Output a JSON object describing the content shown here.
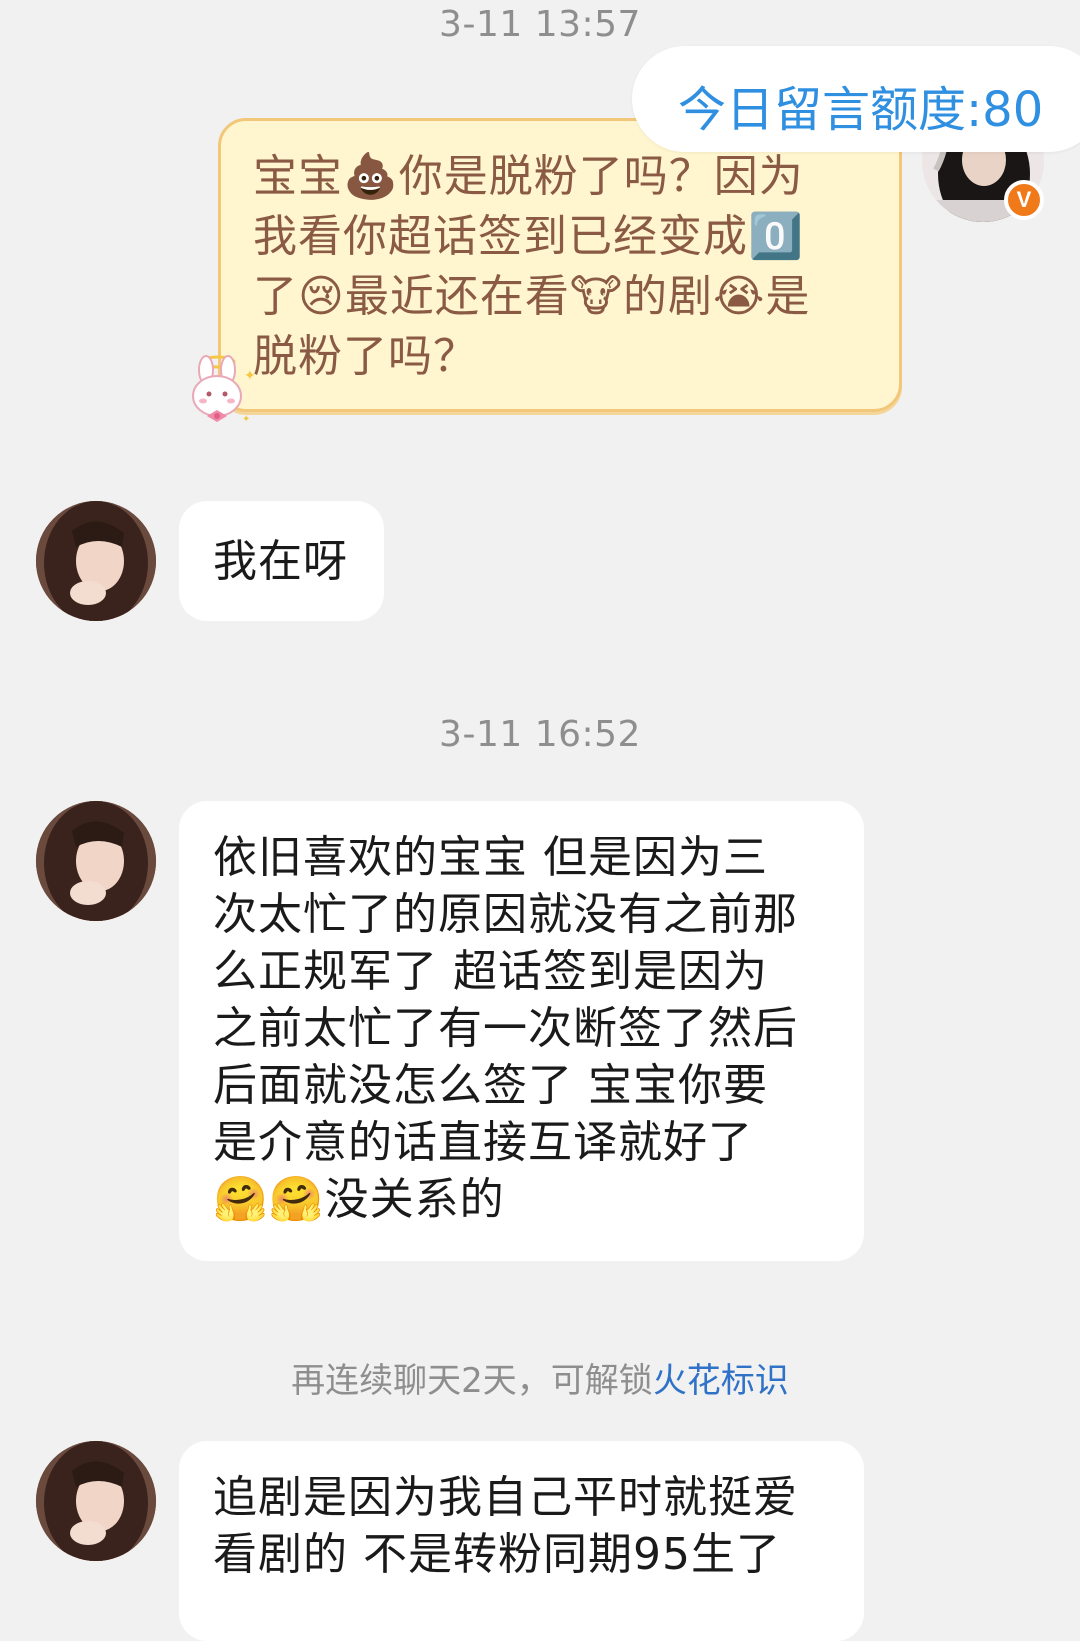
{
  "timestamps": [
    "3-11 13:57",
    "3-11 16:52"
  ],
  "quota": {
    "label": "今日留言额度:80"
  },
  "self_message": {
    "lines": [
      "宝宝💩你是脱粉了吗？因为",
      "我看你超话签到已经变成0️⃣",
      "了😢最近还在看🐮的剧😭是",
      "脱粉了吗？"
    ]
  },
  "messages": [
    {
      "lines": [
        "我在呀"
      ]
    },
    {
      "lines": [
        "依旧喜欢的宝宝 但是因为三",
        "次太忙了的原因就没有之前那",
        "么正规军了 超话签到是因为",
        "之前太忙了有一次断签了然后",
        "后面就没怎么签了 宝宝你要",
        "是介意的话直接互译就好了",
        "🤗🤗没关系的"
      ]
    },
    {
      "lines": [
        "追剧是因为我自己平时就挺爱",
        "看剧的 不是转粉同期95生了"
      ]
    }
  ],
  "notice": {
    "prefix": "再连续聊天2天，可解锁",
    "link": "火花标识"
  },
  "badge": {
    "label": "V",
    "color": "#f07a1a"
  },
  "colors": {
    "link": "#2f8fe0",
    "bubble_border": "#f2c77a",
    "bubble_bg": "#fff6cf"
  }
}
